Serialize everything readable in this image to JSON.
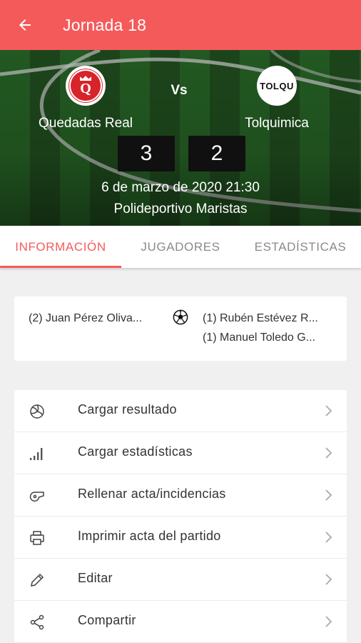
{
  "appbar": {
    "title": "Jornada 18",
    "back_icon": "arrow-left-icon"
  },
  "match": {
    "home": {
      "name": "Quedadas Real",
      "logo_letter": "Q",
      "score": "3"
    },
    "away": {
      "name": "Tolquimica",
      "logo_text": "TOLQU",
      "score": "2"
    },
    "vs_label": "Vs",
    "datetime": "6 de marzo de 2020 21:30",
    "venue": "Polideportivo Maristas"
  },
  "tabs": [
    {
      "label": "INFORMACIÓN",
      "active": true
    },
    {
      "label": "JUGADORES",
      "active": false
    },
    {
      "label": "ESTADÍSTICAS",
      "active": false
    }
  ],
  "scorers": {
    "home": [
      "(2) Juan Pérez Oliva..."
    ],
    "away": [
      "(1) Rubén Estévez R...",
      "(1) Manuel Toledo G..."
    ],
    "icon": "soccer-ball-icon"
  },
  "actions": [
    {
      "label": "Cargar resultado",
      "icon": "volleyball-icon"
    },
    {
      "label": "Cargar estadísticas",
      "icon": "bar-signal-icon"
    },
    {
      "label": "Rellenar acta/incidencias",
      "icon": "whistle-icon"
    },
    {
      "label": "Imprimir acta del partido",
      "icon": "printer-icon"
    },
    {
      "label": "Editar",
      "icon": "pencil-icon"
    },
    {
      "label": "Compartir",
      "icon": "share-icon"
    }
  ],
  "colors": {
    "primary": "#f55a5a",
    "score_box": "#101010",
    "background": "#f0f0f0"
  }
}
